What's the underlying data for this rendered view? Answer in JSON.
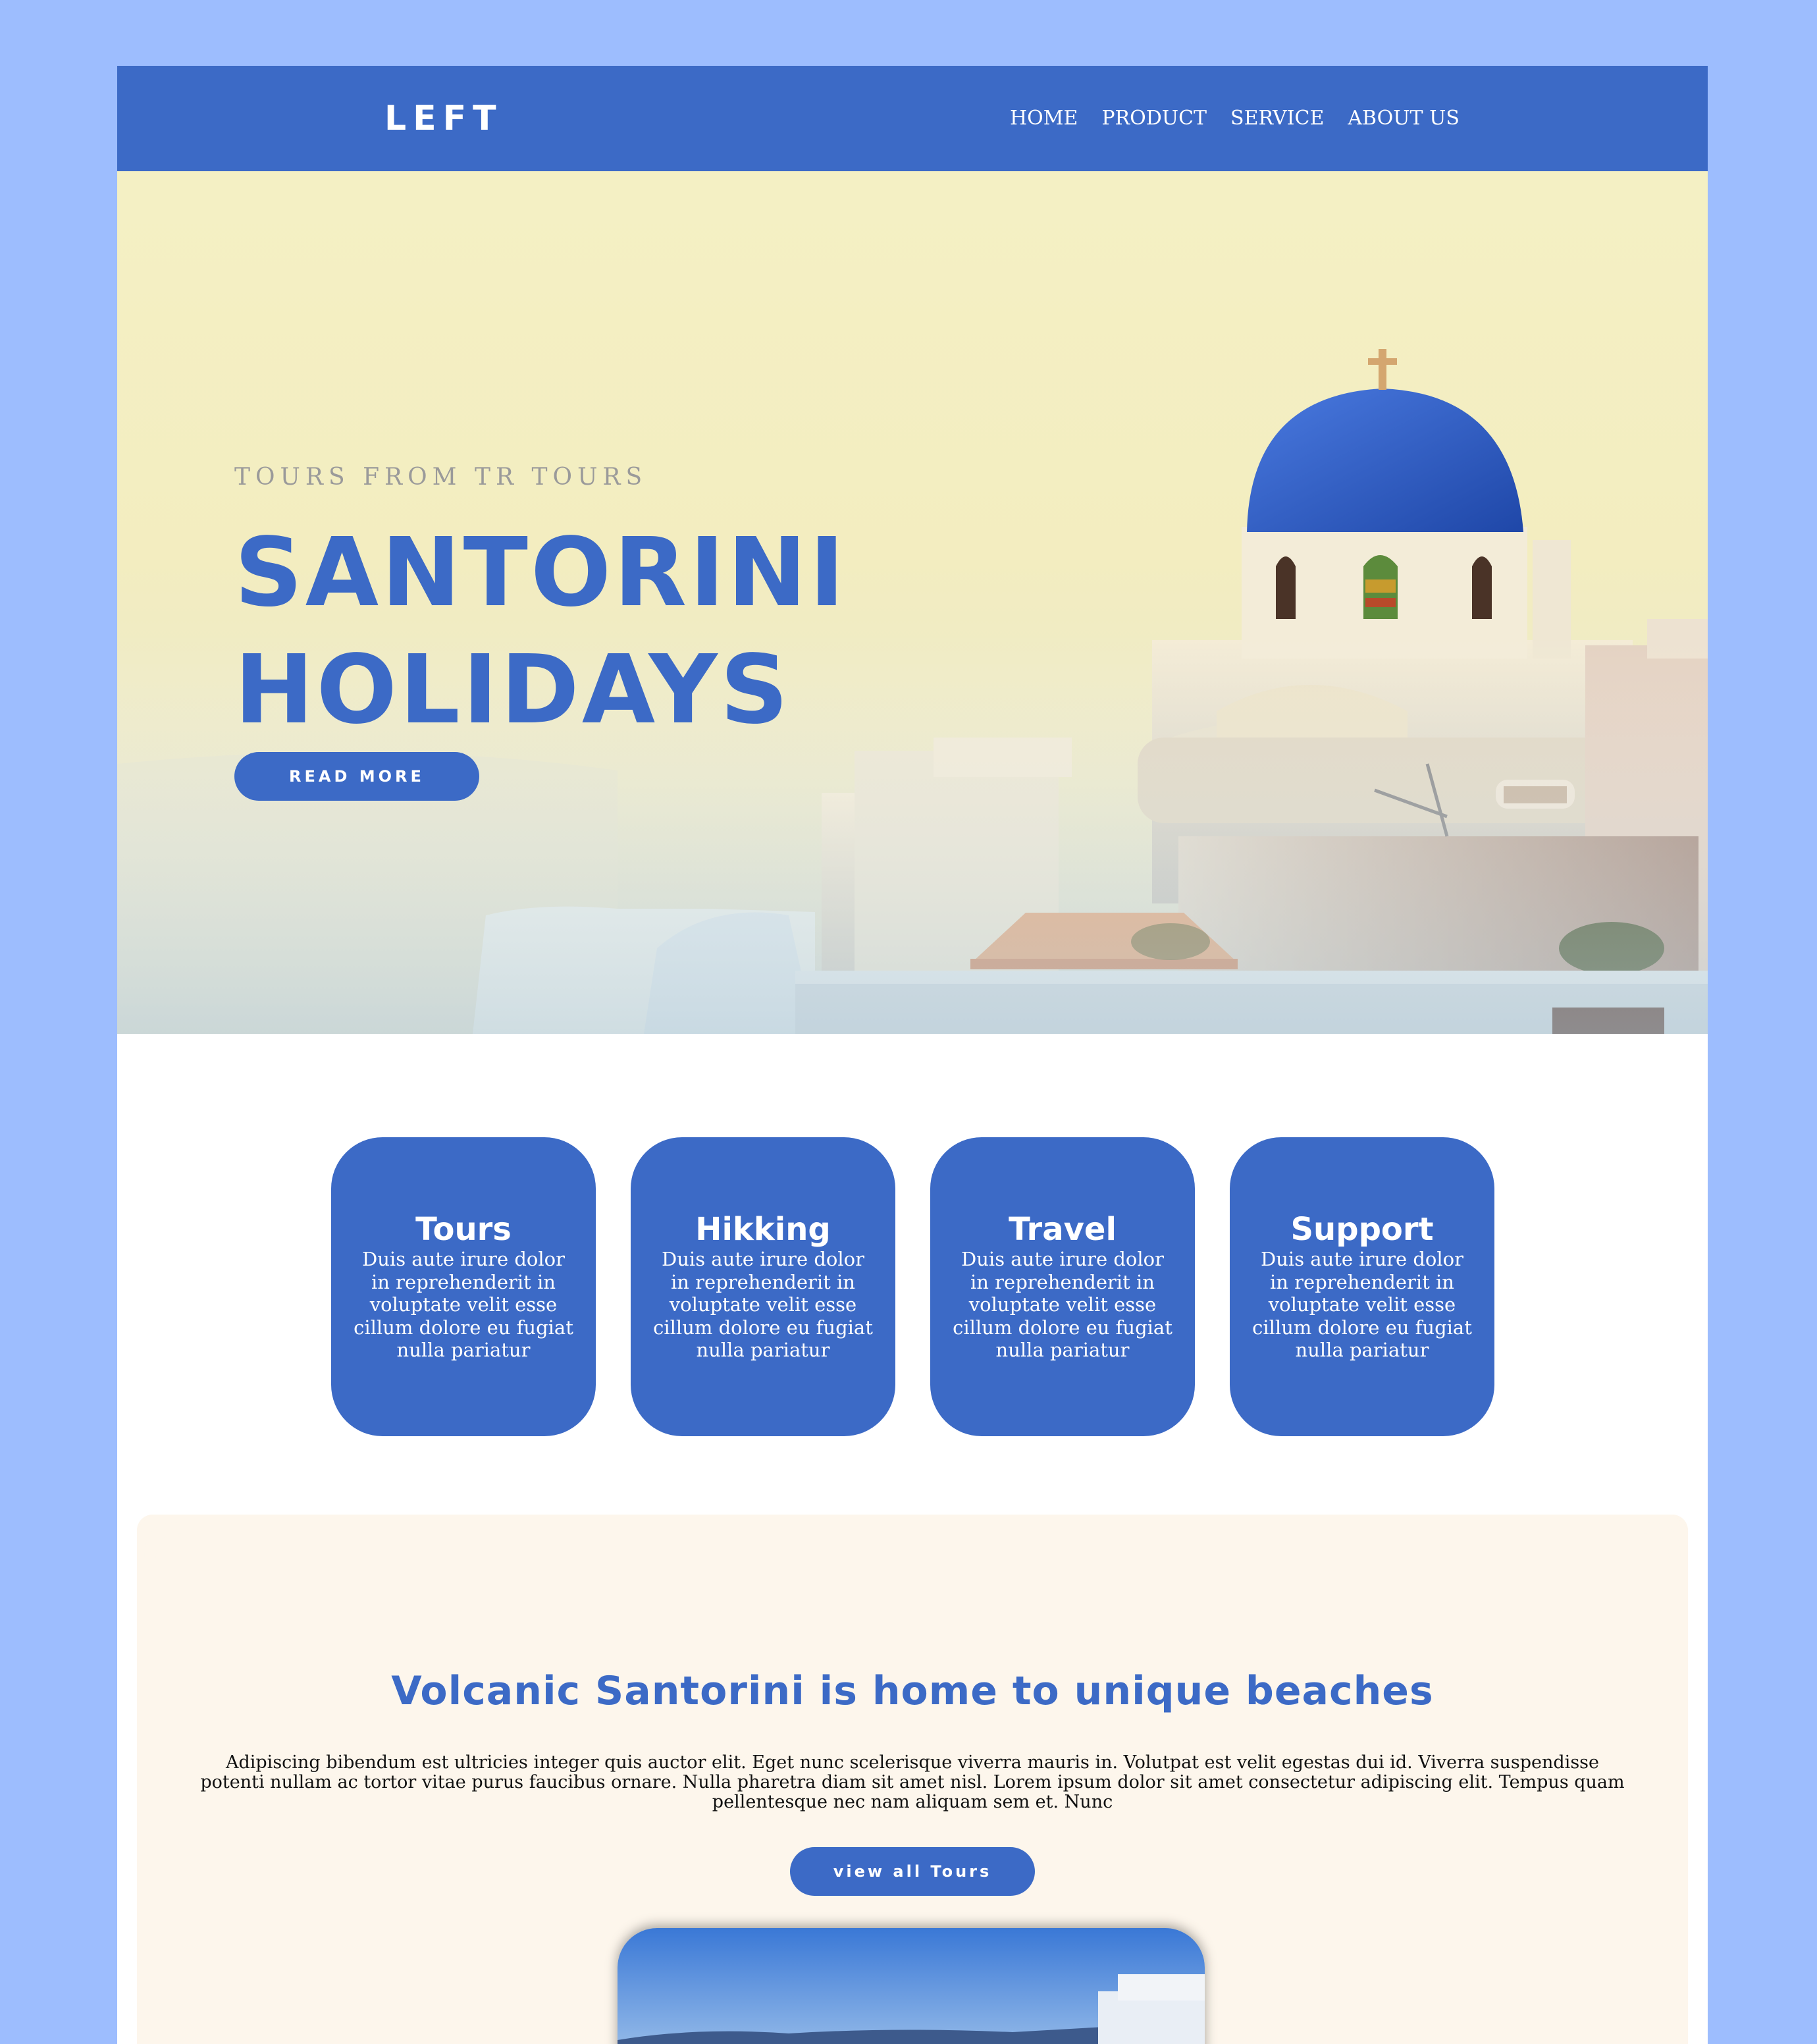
{
  "header": {
    "logo": "LEFT",
    "nav": [
      "HOME",
      "PRODUCT",
      "SERVICE",
      "ABOUT US"
    ]
  },
  "hero": {
    "eyebrow": "TOURS FROM TR TOURS",
    "title_line1": "SANTORINI",
    "title_line2": "HOLIDAYS",
    "button": "READ MORE"
  },
  "services": [
    {
      "title": "Tours",
      "text": "Duis aute irure dolor in reprehenderit in voluptate velit esse cillum dolore eu fugiat nulla pariatur"
    },
    {
      "title": "Hikking",
      "text": "Duis aute irure dolor in reprehenderit in voluptate velit esse cillum dolore eu fugiat nulla pariatur"
    },
    {
      "title": "Travel",
      "text": "Duis aute irure dolor in reprehenderit in voluptate velit esse cillum dolore eu fugiat nulla pariatur"
    },
    {
      "title": "Support",
      "text": "Duis aute irure dolor in reprehenderit in voluptate velit esse cillum dolore eu fugiat nulla pariatur"
    }
  ],
  "beaches": {
    "title": "Volcanic Santorini is home to unique beaches",
    "text": "Adipiscing bibendum est ultricies integer quis auctor elit. Eget nunc scelerisque viverra mauris in. Volutpat est velit egestas dui id. Viverra suspendisse potenti nullam ac tortor vitae purus faucibus ornare. Nulla pharetra diam sit amet nisl. Lorem ipsum dolor sit amet consectetur adipiscing elit. Tempus quam pellentesque nec nam aliquam sem et. Nunc",
    "button": "view all Tours"
  },
  "colors": {
    "page_background": "#9dbdfe",
    "accent": "#3c6ac6",
    "section_background": "#fdf6ec"
  }
}
